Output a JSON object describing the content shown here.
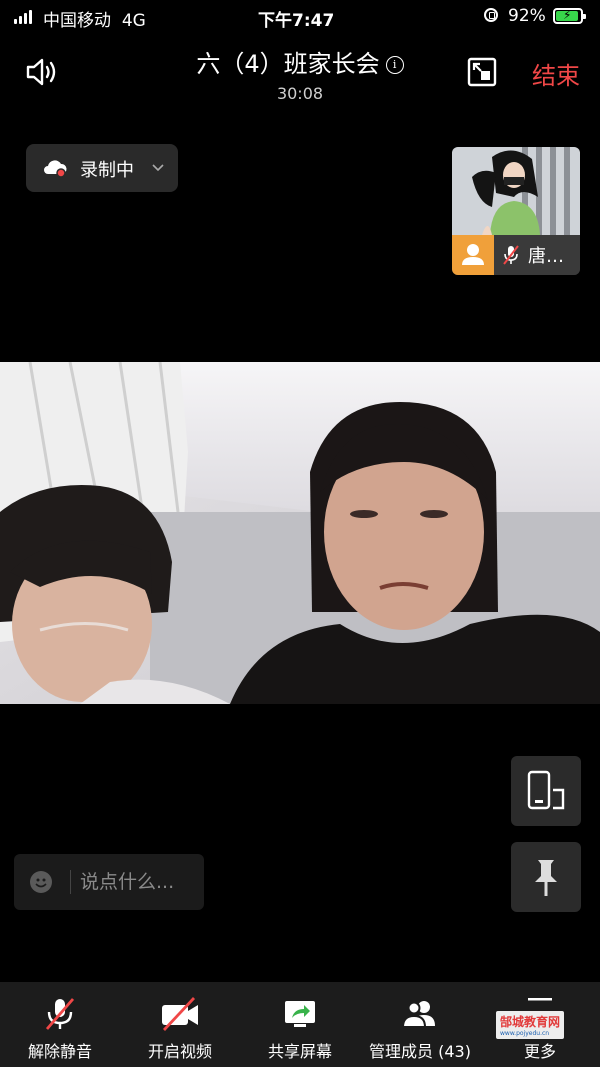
{
  "status_bar": {
    "carrier": "中国移动",
    "network": "4G",
    "time": "下午7:47",
    "battery_pct": "92%",
    "battery_level": 0.92,
    "battery_color": "#38d64b"
  },
  "header": {
    "title": "六（4）班家长会",
    "info_icon": "i",
    "timer": "30:08",
    "end_label": "结束",
    "end_color": "#f04747"
  },
  "recording": {
    "label": "录制中",
    "icon": "cloud-record-icon"
  },
  "thumbnail": {
    "name": "唐…",
    "icons": [
      "person-icon",
      "mic-muted-icon"
    ]
  },
  "chat": {
    "placeholder": "说点什么..."
  },
  "toolbar": {
    "items": [
      {
        "label": "解除静音",
        "icon": "mic-muted-icon"
      },
      {
        "label": "开启视频",
        "icon": "camera-off-icon"
      },
      {
        "label": "共享屏幕",
        "icon": "share-screen-icon"
      },
      {
        "label": "管理成员 (43)",
        "icon": "members-icon"
      },
      {
        "label": "更多",
        "icon": "more-icon"
      }
    ]
  },
  "watermark": {
    "text": "郜城教育网",
    "sub": "www.pojyedu.cn"
  }
}
